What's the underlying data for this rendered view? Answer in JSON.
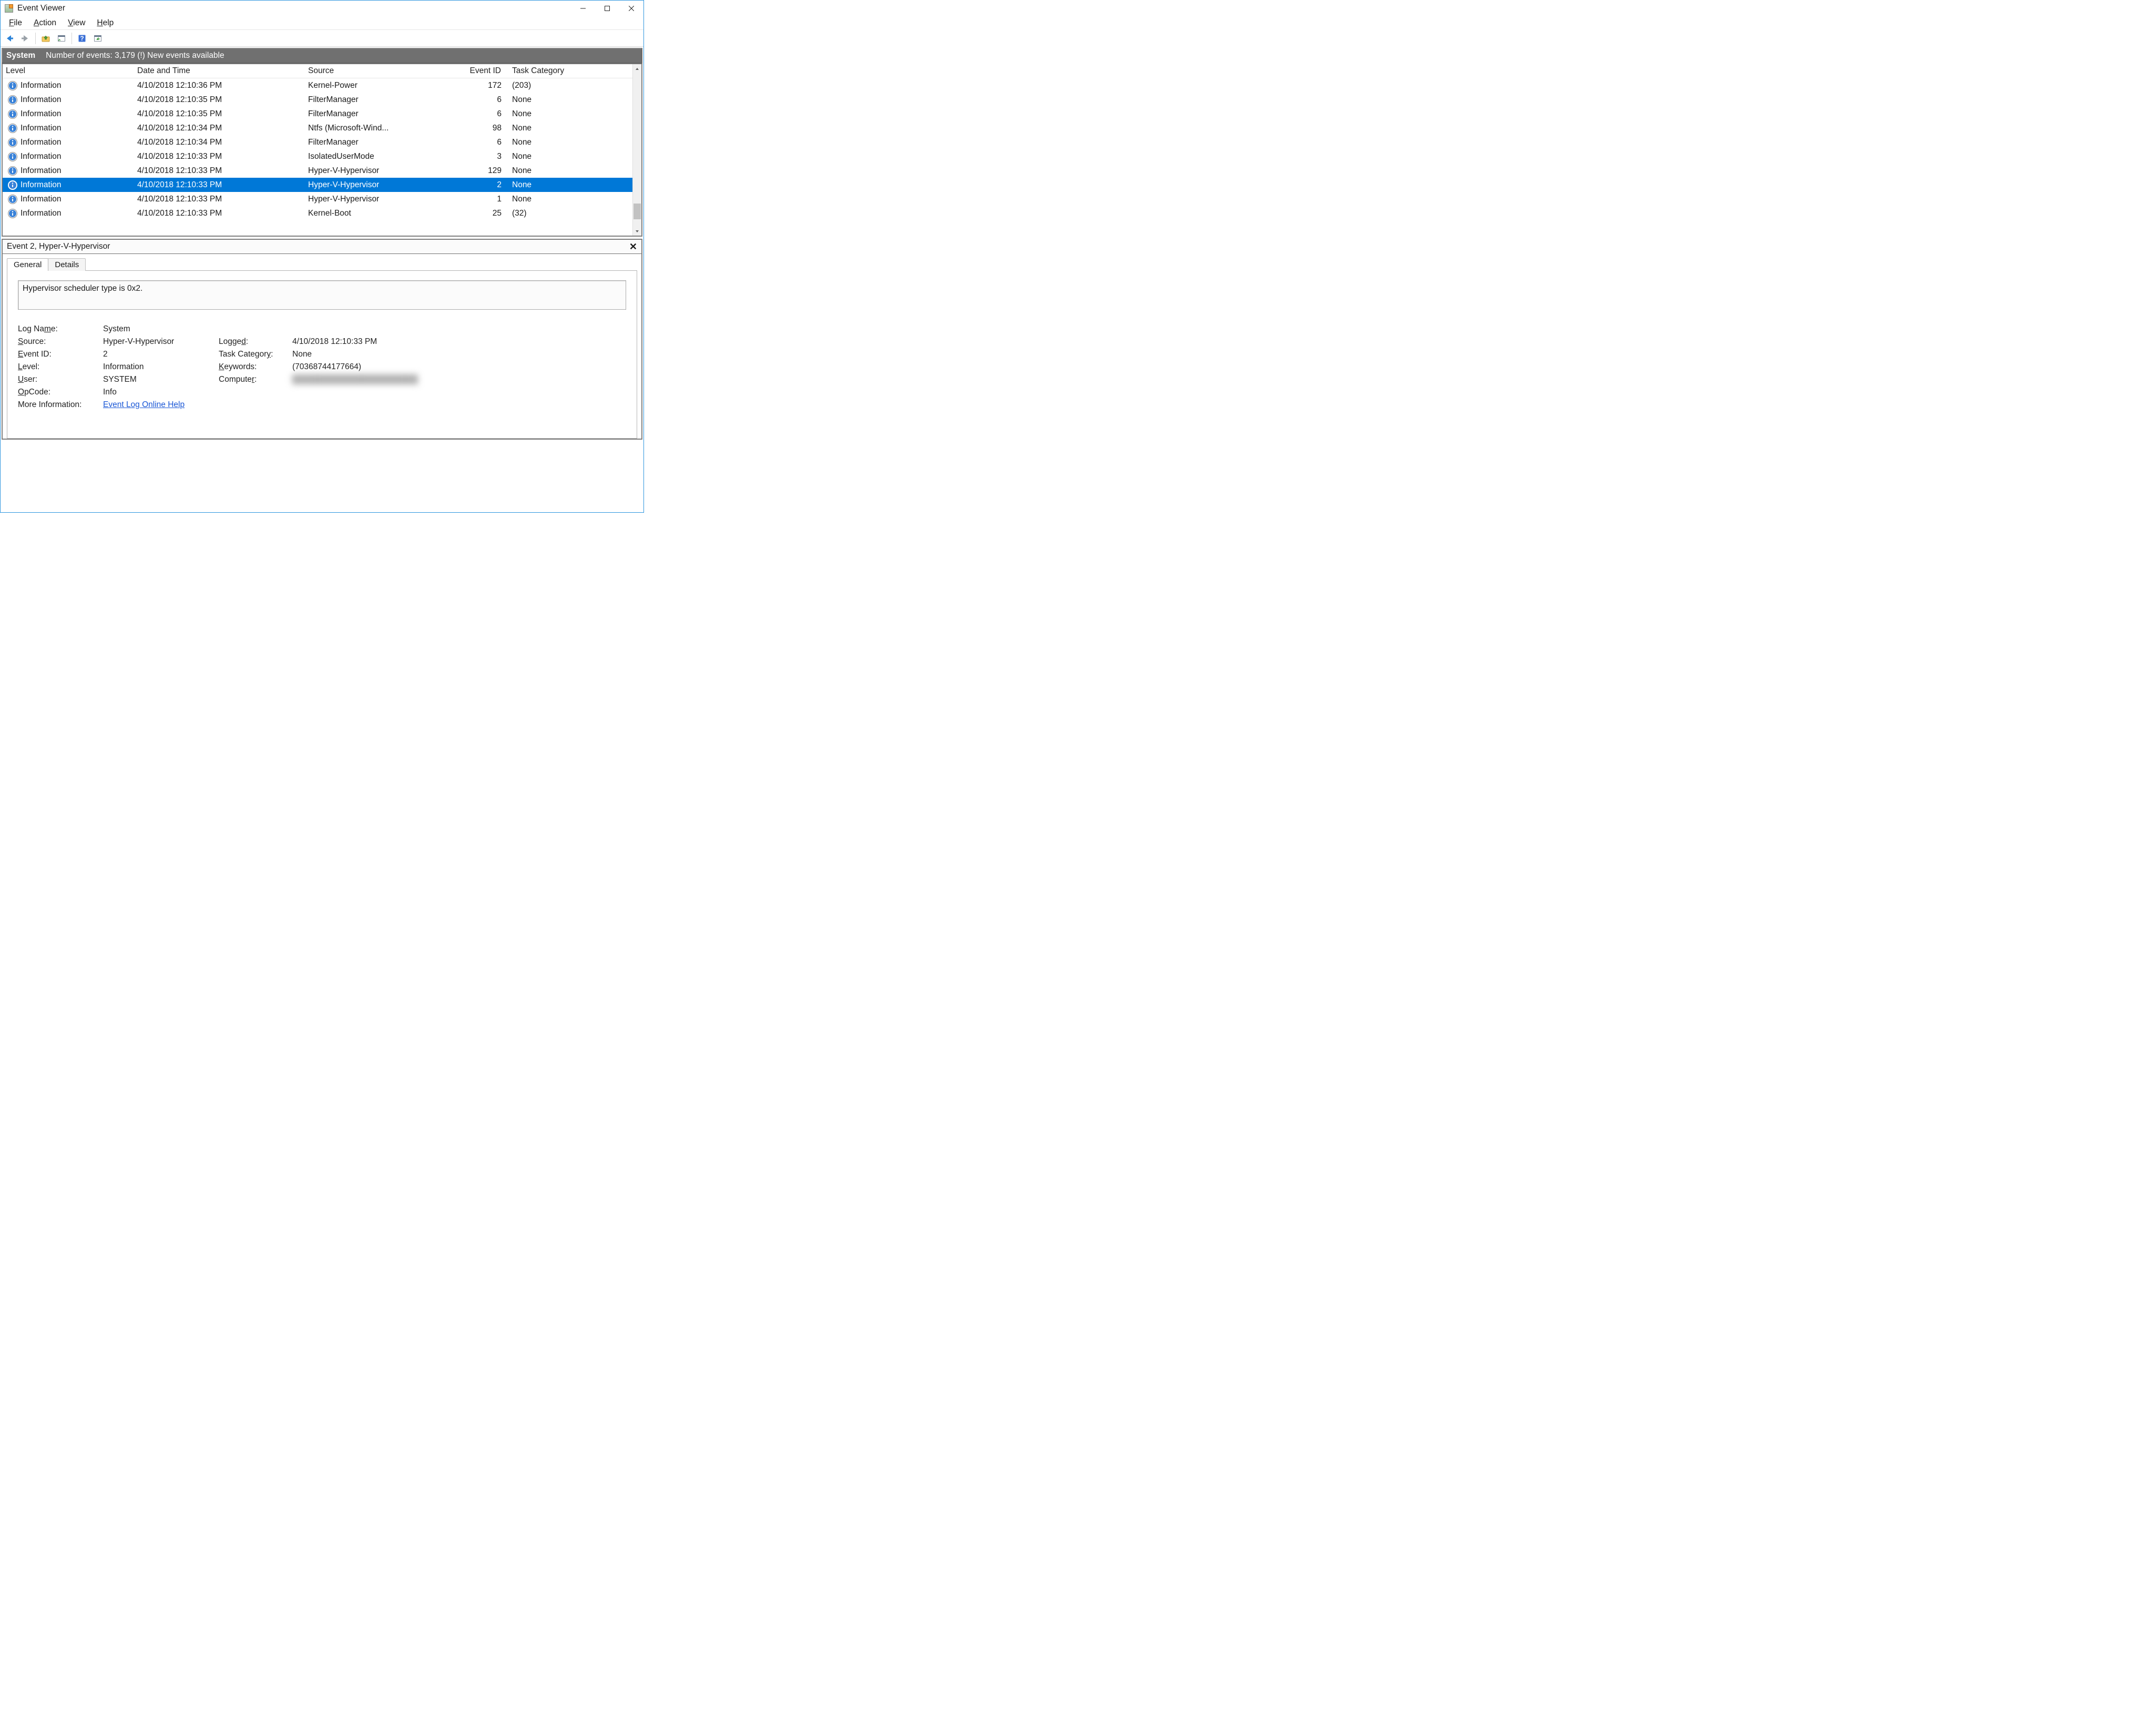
{
  "window": {
    "title": "Event Viewer"
  },
  "menu": {
    "file": "File",
    "action": "Action",
    "view": "View",
    "help": "Help"
  },
  "band": {
    "title": "System",
    "summary": "Number of events: 3,179 (!) New events available"
  },
  "columns": {
    "level": "Level",
    "date": "Date and Time",
    "source": "Source",
    "eventid": "Event ID",
    "category": "Task Category"
  },
  "events": [
    {
      "level": "Information",
      "date": "4/10/2018 12:10:36 PM",
      "source": "Kernel-Power",
      "id": "172",
      "cat": "(203)",
      "selected": false
    },
    {
      "level": "Information",
      "date": "4/10/2018 12:10:35 PM",
      "source": "FilterManager",
      "id": "6",
      "cat": "None",
      "selected": false
    },
    {
      "level": "Information",
      "date": "4/10/2018 12:10:35 PM",
      "source": "FilterManager",
      "id": "6",
      "cat": "None",
      "selected": false
    },
    {
      "level": "Information",
      "date": "4/10/2018 12:10:34 PM",
      "source": "Ntfs (Microsoft-Wind...",
      "id": "98",
      "cat": "None",
      "selected": false
    },
    {
      "level": "Information",
      "date": "4/10/2018 12:10:34 PM",
      "source": "FilterManager",
      "id": "6",
      "cat": "None",
      "selected": false
    },
    {
      "level": "Information",
      "date": "4/10/2018 12:10:33 PM",
      "source": "IsolatedUserMode",
      "id": "3",
      "cat": "None",
      "selected": false
    },
    {
      "level": "Information",
      "date": "4/10/2018 12:10:33 PM",
      "source": "Hyper-V-Hypervisor",
      "id": "129",
      "cat": "None",
      "selected": false
    },
    {
      "level": "Information",
      "date": "4/10/2018 12:10:33 PM",
      "source": "Hyper-V-Hypervisor",
      "id": "2",
      "cat": "None",
      "selected": true
    },
    {
      "level": "Information",
      "date": "4/10/2018 12:10:33 PM",
      "source": "Hyper-V-Hypervisor",
      "id": "1",
      "cat": "None",
      "selected": false
    },
    {
      "level": "Information",
      "date": "4/10/2018 12:10:33 PM",
      "source": "Kernel-Boot",
      "id": "25",
      "cat": "(32)",
      "selected": false
    }
  ],
  "detail": {
    "header": "Event 2, Hyper-V-Hypervisor",
    "tabs": {
      "general": "General",
      "details": "Details"
    },
    "message": "Hypervisor scheduler type is 0x2.",
    "labels": {
      "logname": "Log Name:",
      "source": "Source:",
      "eventid": "Event ID:",
      "level": "Level:",
      "user": "User:",
      "opcode": "OpCode:",
      "moreinfo": "More Information:",
      "logged": "Logged:",
      "category": "Task Category:",
      "keywords": "Keywords:",
      "computer": "Computer:"
    },
    "values": {
      "logname": "System",
      "source": "Hyper-V-Hypervisor",
      "eventid": "2",
      "level": "Information",
      "user": "SYSTEM",
      "opcode": "Info",
      "moreinfo": "Event Log Online Help",
      "logged": "4/10/2018 12:10:33 PM",
      "category": "None",
      "keywords": "(70368744177664)",
      "computer": ""
    }
  }
}
